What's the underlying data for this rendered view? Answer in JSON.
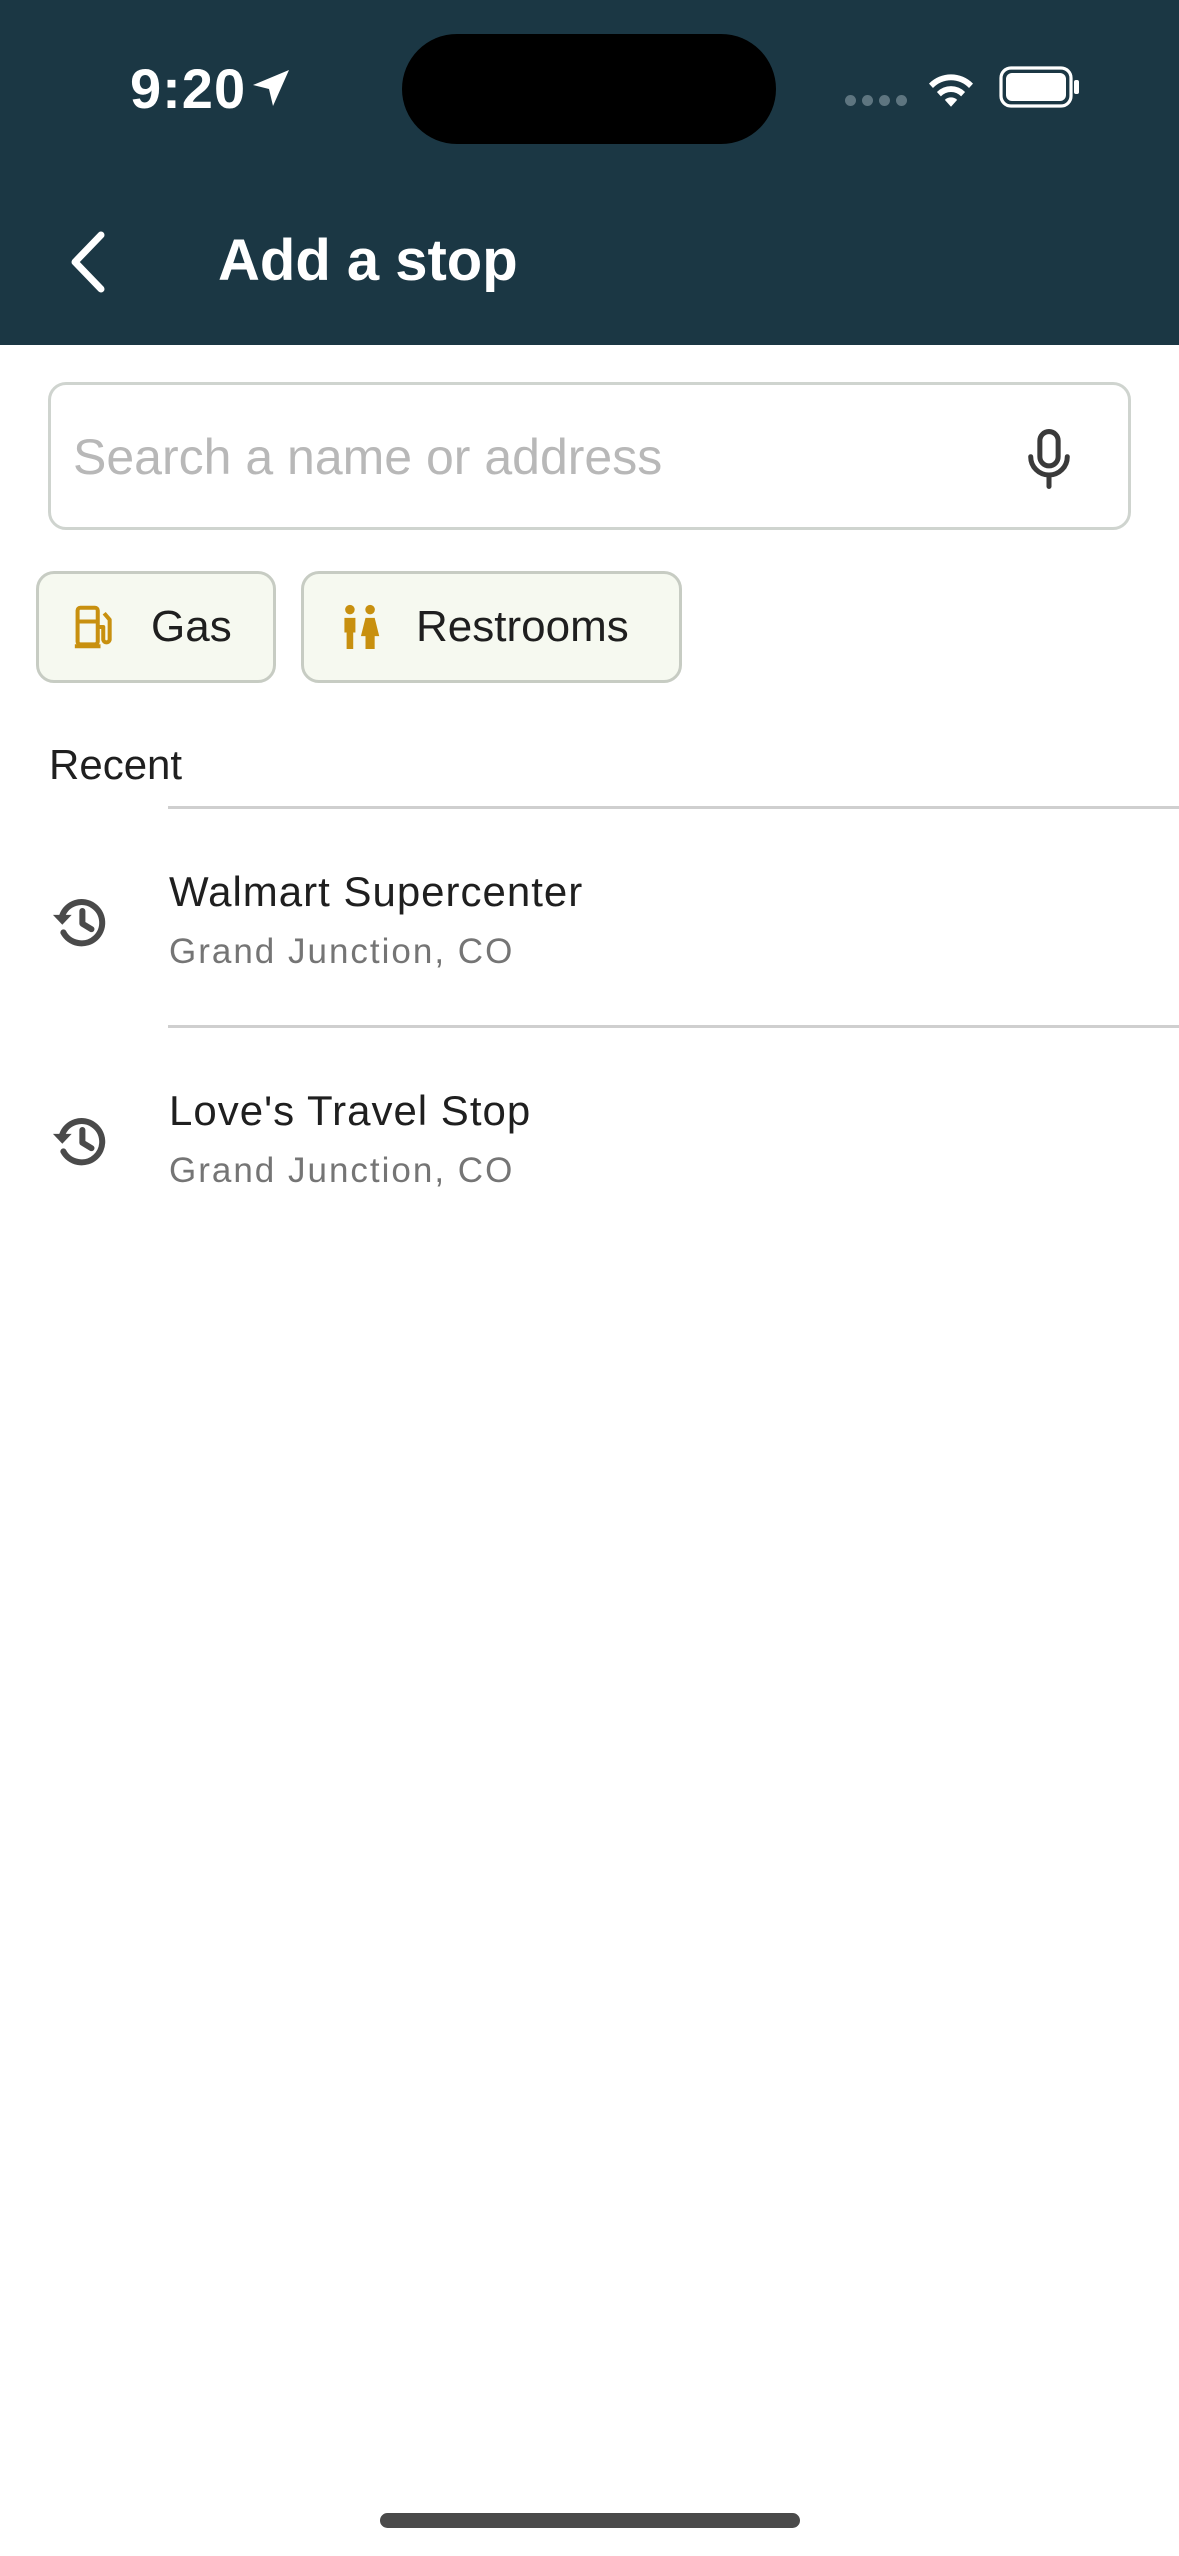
{
  "status_bar": {
    "time": "9:20",
    "icons": [
      "location-arrow-icon",
      "cellular-signal-icon",
      "wifi-icon",
      "battery-icon"
    ]
  },
  "header": {
    "title": "Add a stop",
    "back_icon": "chevron-left-icon",
    "background_color": "#1b3744"
  },
  "search": {
    "placeholder": "Search a name or address",
    "value": "",
    "mic_icon": "microphone-icon"
  },
  "quick_filters": [
    {
      "label": "Gas",
      "icon": "gas-pump-icon"
    },
    {
      "label": "Restrooms",
      "icon": "restroom-icon"
    }
  ],
  "recent": {
    "section_title": "Recent",
    "items": [
      {
        "title": "Walmart Supercenter",
        "subtitle": "Grand Junction, CO",
        "icon": "history-icon"
      },
      {
        "title": "Love's Travel Stop",
        "subtitle": "Grand Junction, CO",
        "icon": "history-icon"
      }
    ]
  },
  "colors": {
    "accent_icon": "#c8900f",
    "chip_background": "#f6f9f0"
  }
}
